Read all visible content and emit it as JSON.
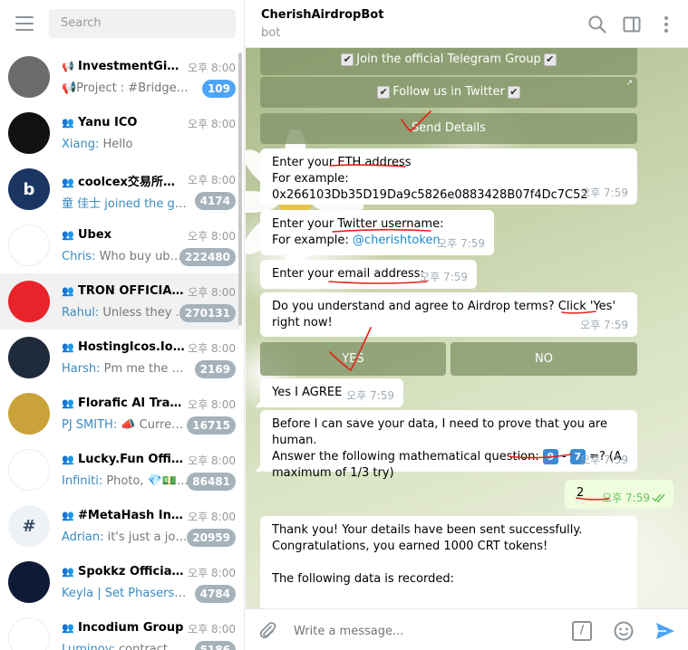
{
  "sidebar": {
    "search_placeholder": "Search",
    "chats": [
      {
        "title": "InvestmentGists...",
        "icon": "channel-icon",
        "time": "오후 8:00",
        "sender": "",
        "preview": "📢Project : #BridgeXNet...",
        "badge": "109",
        "badge_style": "unmuted",
        "avatar_color": "#6b6b6b",
        "avatar_text": ""
      },
      {
        "title": "Yanu ICO",
        "icon": "group-icon",
        "time": "오후 8:00",
        "sender": "Xiang:",
        "preview": " Hello",
        "badge": "",
        "badge_style": "muted",
        "avatar_color": "#111111",
        "avatar_text": ""
      },
      {
        "title": "coolcex交易所中...",
        "icon": "group-icon",
        "time": "오후 8:00",
        "sender": "",
        "preview": "",
        "preview_link": "童 佳士 joined the group",
        "badge": "4174",
        "badge_style": "muted",
        "avatar_color": "#1b3563",
        "avatar_text": "b"
      },
      {
        "title": "Ubex",
        "icon": "group-icon",
        "time": "오후 8:00",
        "sender": "Chris:",
        "preview": " Who buy ubex,...",
        "badge": "222480",
        "badge_style": "muted",
        "avatar_color": "#ffffff",
        "avatar_text": ""
      },
      {
        "title": "TRON OFFICIAL ...",
        "icon": "group-icon",
        "time": "오후 8:00",
        "sender": "Rahul:",
        "preview": " Unless they ke...",
        "badge": "270131",
        "badge_style": "muted",
        "avatar_color": "#e8232a",
        "avatar_text": ""
      },
      {
        "title": "HostingIcos.Io ( ...",
        "icon": "group-icon",
        "time": "오후 8:00",
        "sender": "Harsh:",
        "preview": " Pm me the detai...",
        "badge": "2169",
        "badge_style": "muted",
        "avatar_color": "#1f2a3a",
        "avatar_text": ""
      },
      {
        "title": "Florafic AI Train...",
        "icon": "group-icon",
        "time": "오후 8:00",
        "sender": "PJ SMITH:",
        "preview": " 📣 Current ...",
        "badge": "16715",
        "badge_style": "muted",
        "avatar_color": "#c9a23a",
        "avatar_text": ""
      },
      {
        "title": "Lucky.Fun Official",
        "icon": "group-icon",
        "time": "오후 8:00",
        "sender": "Infiniti:",
        "preview": " Photo, 💎💵...",
        "badge": "86481",
        "badge_style": "muted",
        "avatar_color": "#ffffff",
        "avatar_text": ""
      },
      {
        "title": "#MetaHash Inte...",
        "icon": "group-icon",
        "time": "오후 8:00",
        "sender": "Adrian:",
        "preview": " it's just a joke, ...",
        "badge": "20959",
        "badge_style": "muted",
        "avatar_color": "#eef2f6",
        "avatar_text": "#"
      },
      {
        "title": "Spokkz Official T...",
        "icon": "group-icon",
        "time": "오후 8:00",
        "sender": "Keyla | Set Phasers To ...",
        "preview": "",
        "badge": "4784",
        "badge_style": "muted",
        "avatar_color": "#0d1b36",
        "avatar_text": ""
      },
      {
        "title": "Incodium Group",
        "icon": "group-icon",
        "time": "오후 8:00",
        "sender": "Luminoy:",
        "preview": " contract paus...",
        "badge": "5186",
        "badge_style": "muted",
        "avatar_color": "#ffffff",
        "avatar_text": ""
      }
    ]
  },
  "chat": {
    "title": "CherishAirdropBot",
    "subtitle": "bot",
    "keyboard_top": {
      "join_group": "Join the official Telegram Group",
      "follow_twitter": "Follow us in Twitter",
      "send_details": "Send Details"
    },
    "messages": {
      "eth_line1_prefix": "Enter your ",
      "eth_line1_hl": "ETH address",
      "eth_line2": "For example: 0x266103Db35D19Da9c5826e0883428B07f4Dc7C52",
      "eth_time": "오후 7:59",
      "tw_line1_prefix": "Enter your ",
      "tw_line1_hl": "Twitter username:",
      "tw_line2_prefix": "For example: ",
      "tw_line2_link": "@cherishtoken",
      "tw_time": "오후 7:59",
      "email_text": "Enter your email address:",
      "email_time": "오후 7:59",
      "terms_text": "Do you understand and agree to Airdrop terms? Click 'Yes' right now!",
      "terms_time": "오후 7:59",
      "yes_btn": "YES",
      "no_btn": "NO",
      "agree_text": "Yes I AGREE",
      "agree_time": "오후 7:59",
      "human_line1": "Before I can save your data, I need to prove that you are human.",
      "human_line2_a": "Answer the following mathematical question: ",
      "human_num1": "9",
      "human_minus": " - ",
      "human_num2": "7",
      "human_line2_b": " =? (A",
      "human_line3": "maximum of 1/3 try)",
      "human_time": "오후 7:59",
      "answer_text": "2",
      "answer_time": "오후 7:59",
      "thanks_line1": "Thank you! Your details have been sent successfully.",
      "thanks_line2": "Congratulations, you earned 1000 CRT  tokens!",
      "thanks_line3": "The following data is recorded:"
    },
    "composer_placeholder": "Write a message...",
    "command_label": "/"
  }
}
